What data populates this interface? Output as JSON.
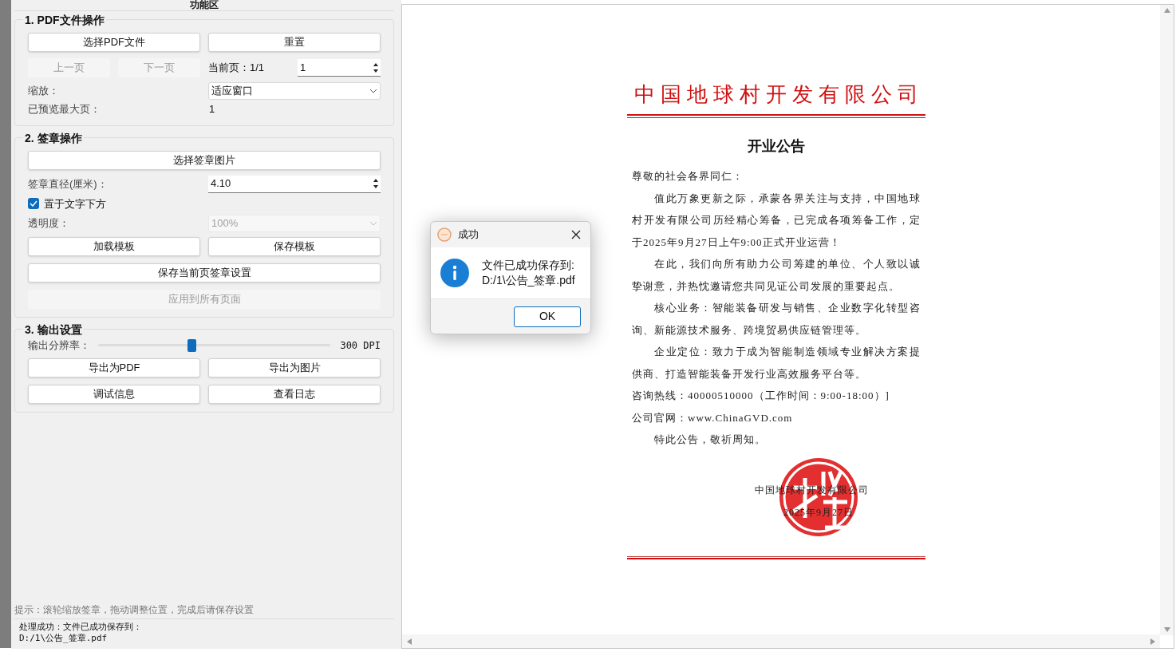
{
  "panel_title": "功能区",
  "pdf_section": {
    "title": "1. PDF文件操作",
    "select_button": "选择PDF文件",
    "reset_button": "重置",
    "prev_button": {
      "label": "上一页",
      "disabled": true
    },
    "next_button": {
      "label": "下一页",
      "disabled": true
    },
    "current_page": "当前页：1/1",
    "page_input": "1",
    "zoom_label": "缩放：",
    "zoom_select": "适应窗口",
    "max_page_label": "已预览最大页：",
    "max_page_value": "1"
  },
  "stamp_section": {
    "title": "2. 签章操作",
    "choose_button": "选择签章图片",
    "diameter_label": "签章直径(厘米)：",
    "diameter_input": "4.10",
    "below_text": {
      "label": "置于文字下方",
      "checked": true
    },
    "opacity_label": "透明度：",
    "opacity_select": {
      "value": "100%",
      "disabled": true
    },
    "load_button": "加载模板",
    "save_button": "保存模板",
    "save_page_button": "保存当前页签章设置",
    "apply_all_button": {
      "label": "应用到所有页面",
      "disabled": true
    }
  },
  "output_section": {
    "title": "3. 输出设置",
    "resolution_label": "输出分辨率：",
    "resolution": {
      "level": 0.4,
      "reading": "300 DPI"
    },
    "buttons": [
      "导出为PDF",
      "导出为图片",
      "调试信息",
      "查看日志"
    ]
  },
  "hint": "提示：滚轮缩放签章，拖动调整位置，完成后请保存设置",
  "status_lines": [
    "处理成功：文件已成功保存到：",
    "D:/1\\公告_签章.pdf"
  ],
  "document": {
    "company": "中国地球村开发有限公司",
    "title": "开业公告",
    "paragraphs": [
      {
        "text": "尊敬的社会各界同仁：",
        "indent": false
      },
      {
        "text": "值此万象更新之际，承蒙各界关注与支持，中国地球村开发有限公司历经精心筹备，已完成各项筹备工作，定于2025年9月27日上午9:00正式开业运营！",
        "indent": true
      },
      {
        "text": "在此，我们向所有助力公司筹建的单位、个人致以诚挚谢意，并热忱邀请您共同见证公司发展的重要起点。",
        "indent": true
      },
      {
        "text": "核心业务：智能装备研发与销售、企业数字化转型咨询、新能源技术服务、跨境贸易供应链管理等。",
        "indent": true
      },
      {
        "text": "企业定位：致力于成为智能制造领域专业解决方案提供商、打造智能装备开发行业高效服务平台等。",
        "indent": true
      },
      {
        "text": "咨询热线：40000510000（工作时间：9:00-18:00）]",
        "indent": false
      },
      {
        "text": "公司官网：www.ChinaGVD.com",
        "indent": false
      },
      {
        "text": "特此公告，敬祈周知。",
        "indent": true
      }
    ],
    "signature": "中国地球村开发有限公司",
    "date": "2025年9月27日"
  },
  "dialog": {
    "title": "成功",
    "message_lines": [
      "文件已成功保存到:",
      "D:/1\\公告_签章.pdf"
    ],
    "ok_button": "OK"
  }
}
